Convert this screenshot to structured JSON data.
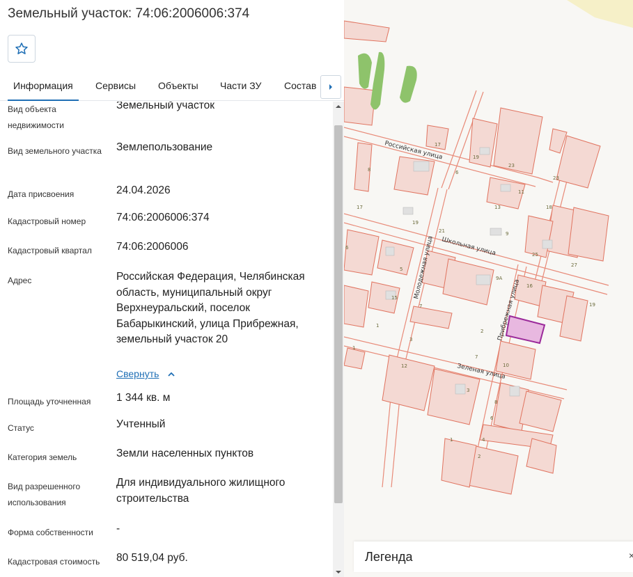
{
  "title": "Земельный участок: 74:06:2006006:374",
  "tabs": [
    {
      "label": "Информация",
      "active": true
    },
    {
      "label": "Сервисы"
    },
    {
      "label": "Объекты"
    },
    {
      "label": "Части ЗУ"
    },
    {
      "label": "Состав"
    }
  ],
  "fields": [
    {
      "label": "Вид объекта недвижимости",
      "value": "Земельный участок"
    },
    {
      "label": "Вид земельного участка",
      "value": "Землепользование"
    },
    {
      "label": "Дата присвоения",
      "value": "24.04.2026"
    },
    {
      "label": "Кадастровый номер",
      "value": "74:06:2006006:374"
    },
    {
      "label": "Кадастровый квартал",
      "value": "74:06:2006006"
    },
    {
      "label": "Адрес",
      "value": "Российская Федерация, Челябинская область, муниципальный округ Верхнеуральский, поселок Бабарыкинский, улица Прибрежная, земельный участок 20"
    },
    {
      "label": "Площадь уточненная",
      "value": "1 344 кв. м"
    },
    {
      "label": "Статус",
      "value": "Учтенный"
    },
    {
      "label": "Категория земель",
      "value": "Земли населенных пунктов"
    },
    {
      "label": "Вид разрешенного использования",
      "value": "Для индивидуального жилищного строительства"
    },
    {
      "label": "Форма собственности",
      "value": "-"
    },
    {
      "label": "Кадастровая стоимость",
      "value": "80 519,04 руб."
    }
  ],
  "collapse_label": "Свернуть",
  "map": {
    "streets": {
      "rossiyskaya": "Российская улица",
      "shkolnaya": "Школьная улица",
      "molodezhnaya": "Молодежная улица",
      "pribrezhnaya": "Прибрежная улица",
      "zelenaya": "Зеленая улица"
    },
    "house_numbers": [
      "17",
      "19",
      "23",
      "8",
      "6",
      "11",
      "13",
      "18",
      "17",
      "19",
      "21",
      "9",
      "23",
      "25",
      "27",
      "6",
      "5",
      "9А",
      "16",
      "15",
      "19",
      "7",
      "1",
      "2",
      "3",
      "7",
      "10",
      "1",
      "12",
      "3",
      "8",
      "6",
      "4",
      "2",
      "1",
      "19"
    ],
    "colors": {
      "parcel": "#f4d9d3",
      "parcel_stroke": "#e0735f",
      "highlight": "#e8b8e0",
      "highlight_stroke": "#9b2a9b",
      "greenery": "#8ec36b"
    }
  },
  "legend": {
    "title": "Легенда",
    "close": "×"
  }
}
